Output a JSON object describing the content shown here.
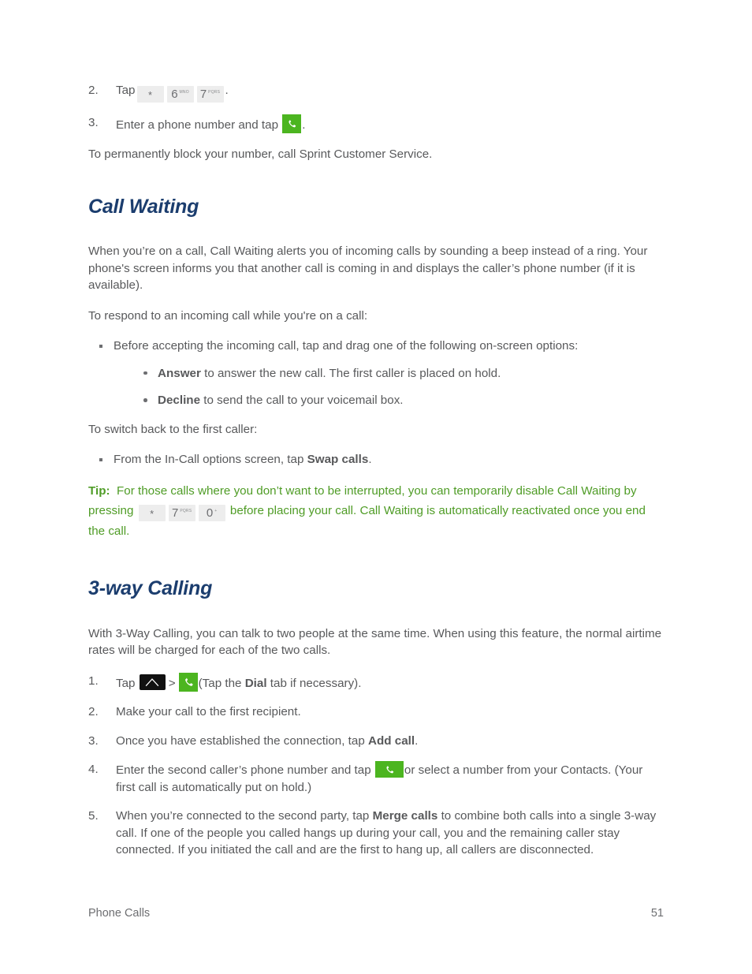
{
  "document": {
    "footer_left": "Phone Calls",
    "page_number": "51"
  },
  "colors": {
    "heading": "#1b3d6e",
    "body_text": "#58595b",
    "tip_green": "#4f9c26",
    "phone_icon_green": "#4cb520",
    "keycap_bg": "#ededed"
  },
  "top_steps": {
    "step2": {
      "number": "2.",
      "text_before": "Tap",
      "keys": [
        {
          "digit": "*",
          "letters": ""
        },
        {
          "digit": "6",
          "letters": "MNO"
        },
        {
          "digit": "7",
          "letters": "PQRS"
        }
      ],
      "text_after": "."
    },
    "step3": {
      "number": "3.",
      "text_before": "Enter a phone number and tap",
      "icon": "phone-call-icon",
      "text_after": "."
    },
    "note": "To permanently block your number, call Sprint Customer Service."
  },
  "call_waiting": {
    "heading": "Call Waiting",
    "intro": "When you’re on a call, Call Waiting alerts you of incoming calls by sounding a beep instead of a ring. Your phone's screen informs you that another call is coming in and displays the caller’s phone number (if it is available).",
    "lead_in_1": "To respond to an incoming call while you're on a call:",
    "bullet_1": "Before accepting the incoming call, tap and drag one of the following on-screen options:",
    "sub_bullets": [
      {
        "bold": "Answer",
        "rest": " to answer the new call. The first caller is placed on hold."
      },
      {
        "bold": "Decline",
        "rest": " to send the call to your voicemail box."
      }
    ],
    "lead_in_2": "To switch back to the first caller:",
    "bullet_2_before": "From the In-Call options screen, tap ",
    "bullet_2_bold": "Swap calls",
    "bullet_2_after": ".",
    "tip": {
      "label": "Tip:",
      "part1": "For those calls where you don’t want to be interrupted, you can temporarily disable Call Waiting by pressing",
      "keys": [
        {
          "digit": "*",
          "letters": ""
        },
        {
          "digit": "7",
          "letters": "PQRS"
        },
        {
          "digit": "0",
          "letters": "+"
        }
      ],
      "part2": "before placing your call. Call Waiting is automatically reactivated once you end the call."
    }
  },
  "three_way_calling": {
    "heading": "3-way Calling",
    "intro": "With 3-Way Calling, you can talk to two people at the same time. When using this feature, the normal airtime rates will be charged for each of the two calls.",
    "steps": [
      {
        "number": "1.",
        "text_before": "Tap",
        "icon_home": "home-button-icon",
        "separator": ">",
        "icon_phone": "phone-call-icon",
        "text_mid": "(Tap the ",
        "bold": "Dial",
        "text_after": " tab if necessary)."
      },
      {
        "number": "2.",
        "text": "Make your call to the first recipient."
      },
      {
        "number": "3.",
        "text_before": "Once you have established the connection, tap ",
        "bold": "Add call",
        "text_after": "."
      },
      {
        "number": "4.",
        "text_before": "Enter the second caller’s phone number and tap",
        "icon": "phone-call-icon",
        "text_after": "or select a number from your Contacts. (Your first call is automatically put on hold.)"
      },
      {
        "number": "5.",
        "text_before": "When you’re connected to the second party, tap ",
        "bold": "Merge calls",
        "text_after": " to combine both calls into a single 3-way call. If one of the people you called hangs up during your call, you and the remaining caller stay connected. If you initiated the call and are the first to hang up, all callers are disconnected."
      }
    ]
  }
}
